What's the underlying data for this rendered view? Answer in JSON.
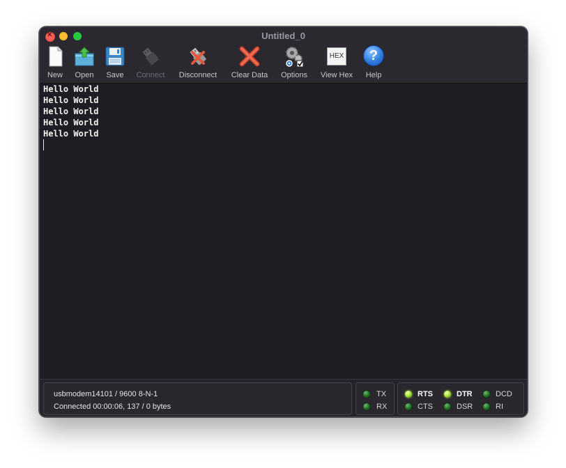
{
  "window": {
    "title": "Untitled_0"
  },
  "toolbar": {
    "new_label": "New",
    "open_label": "Open",
    "save_label": "Save",
    "connect_label": "Connect",
    "connect_enabled": false,
    "disconnect_label": "Disconnect",
    "clear_label": "Clear Data",
    "options_label": "Options",
    "viewhex_label": "View Hex",
    "viewhex_icon_text": "HEX",
    "help_label": "Help",
    "help_icon_text": "?"
  },
  "terminal": {
    "lines": [
      "Hello World",
      "Hello World",
      "Hello World",
      "Hello World",
      "Hello World"
    ]
  },
  "status": {
    "port_line": "usbmodem14101 / 9600 8-N-1",
    "connection_line": "Connected 00:00:06, 137 / 0 bytes"
  },
  "signals": {
    "tx": {
      "label": "TX",
      "on": false
    },
    "rx": {
      "label": "RX",
      "on": false
    },
    "rts": {
      "label": "RTS",
      "on": true
    },
    "cts": {
      "label": "CTS",
      "on": false
    },
    "dtr": {
      "label": "DTR",
      "on": true
    },
    "dsr": {
      "label": "DSR",
      "on": false
    },
    "dcd": {
      "label": "DCD",
      "on": false
    },
    "ri": {
      "label": "RI",
      "on": false
    }
  },
  "colors": {
    "terminal_bg": "#1f1c24",
    "led_on": "#b8f046",
    "led_off": "#1f6b23",
    "close": "#ff5f57",
    "minimize": "#febc2e",
    "zoom": "#28c840"
  }
}
